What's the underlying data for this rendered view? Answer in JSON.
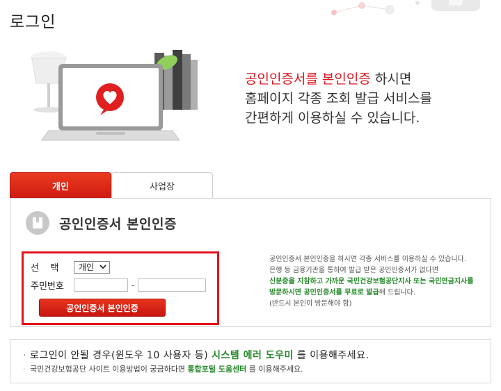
{
  "page": {
    "title": "로그인"
  },
  "hero": {
    "line1_accent": "공인인증서를 본인인증",
    "line1_rest": " 하시면",
    "line2": "홈페이지 각종 조회 발급 서비스를",
    "line3": "간편하게 이용하실 수 있습니다."
  },
  "tabs": [
    {
      "label": "개인",
      "active": true
    },
    {
      "label": "사업장",
      "active": false
    }
  ],
  "panel": {
    "title": "공인인증서 본인인증",
    "select_label": "선    택",
    "select_value": "개인",
    "rrn_label": "주민번호",
    "rrn_dash": "-",
    "submit_label": "공인인증서 본인인증"
  },
  "guide": {
    "line1": "공인인증서 본인인증을 하시면 각종 서비스를 이용하실 수 있습니다.",
    "line2": "은행 등 금융기관을 통하여 발급 받은 공인인증서가 없다면",
    "line3_green": "신분증을 지참하고 가까운 국민건강보험공단지사 또는 국민연금지사를",
    "line4_green": "방문하시면 공인인증서를 무료로 발급",
    "line4_rest": "해 드립니다.",
    "line5": "(반드시 본인이 방문해야 함)"
  },
  "notice": {
    "line1_pre": "로그인이 안될 경우(윈도우 10 사용자 등) ",
    "line1_link": "시스템 에러 도우미",
    "line1_post": " 를 이용해주세요.",
    "line2_pre": "국민건강보험공단 사이트 이용방법이 궁금하다면 ",
    "line2_link": "통합포털 도움센터",
    "line2_post": " 를 이용해주세요."
  },
  "colors": {
    "accent": "#d9171f",
    "green": "#258a2a",
    "border": "#d4d4d4"
  },
  "icons": {
    "hero": "laptop-heart-illustration",
    "panel": "certificate-icon",
    "select": "chevron-down-icon"
  }
}
